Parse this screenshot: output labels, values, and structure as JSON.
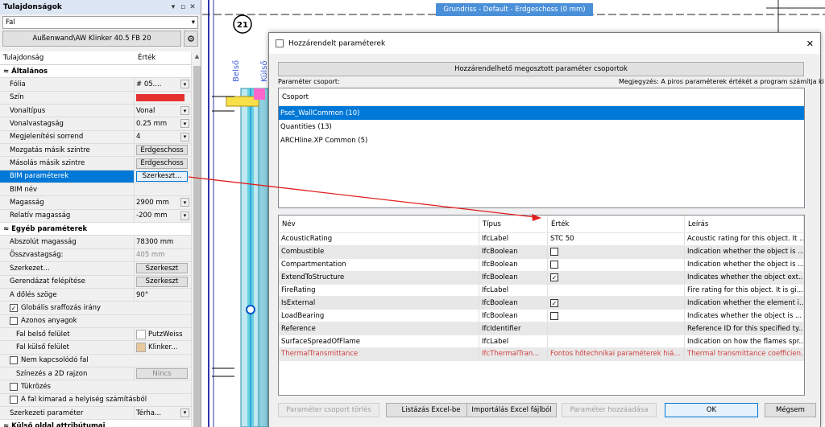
{
  "left_panel": {
    "title": "Tulajdonságok",
    "combo_value": "Fal",
    "type_button": "Außenwand\\AW Klinker 40.5 FB 20",
    "col_property": "Tulajdonság",
    "col_value": "Érték",
    "rows": [
      {
        "kind": "sec",
        "label": "Általános"
      },
      {
        "label": "Fólia",
        "value": "# 05....",
        "dd": true
      },
      {
        "label": "Szín",
        "swatch": "#e53030"
      },
      {
        "label": "Vonaltípus",
        "value": "Vonal",
        "dd": true
      },
      {
        "label": "Vonalvastagság",
        "value": "0.25 mm",
        "dd": true
      },
      {
        "label": "Megjelenítési sorrend",
        "value": "4",
        "dd": true
      },
      {
        "label": "Mozgatás másik szintre",
        "button": "Erdgeschoss"
      },
      {
        "label": "Másolás másik szintre",
        "button": "Erdgeschoss"
      },
      {
        "label": "BIM paraméterek",
        "button": "Szerkeszt...",
        "selected": true
      },
      {
        "label": "BIM név"
      },
      {
        "label": "Magasság",
        "value": "2900 mm",
        "dd": true
      },
      {
        "label": "Relatív magasság",
        "value": "-200 mm",
        "dd": true
      },
      {
        "kind": "sec",
        "label": "Egyéb paraméterek"
      },
      {
        "label": "Abszolút magasság",
        "value": "78300 mm"
      },
      {
        "label": "Összvastagság:",
        "value": "405 mm",
        "muted": true
      },
      {
        "label": "Szerkezet...",
        "button": "Szerkeszt"
      },
      {
        "label": "Gerendázat felépítése",
        "button": "Szerkeszt"
      },
      {
        "label": "A dőlés szöge",
        "value": "90°"
      },
      {
        "label": "Globális sraffozás irány",
        "check": true,
        "checked": true,
        "full": true
      },
      {
        "label": "Azonos anyagok",
        "check": true,
        "checked": false,
        "full": true
      },
      {
        "label": "Fal belső felület",
        "value": "PutzWeiss",
        "swatch": "#ffffff",
        "indent": true
      },
      {
        "label": "Fal külső felület",
        "value": "Klinker...",
        "swatch": "#e8c89a",
        "indent": true
      },
      {
        "label": "Nem kapcsolódó fal",
        "check": true,
        "checked": false,
        "full": true
      },
      {
        "label": "Színezés a 2D rajzon",
        "button": "Nincs",
        "indent": true,
        "muted": true
      },
      {
        "label": "Tükrözés",
        "check": true,
        "checked": false,
        "full": true
      },
      {
        "label": "A fal kimarad a helyiség számításból",
        "check": true,
        "checked": false,
        "full": true
      },
      {
        "label": "Szerkezeti paraméter",
        "value": "Térha...",
        "dd": true
      },
      {
        "kind": "sec",
        "label": "Külső oldal attribútumai"
      }
    ]
  },
  "cad": {
    "view_title": "Grundriss - Default - Erdgeschoss (0 mm)",
    "marker": "21",
    "label_belso": "Belső",
    "label_kulso": "Külső"
  },
  "dialog": {
    "title": "Hozzárendelt paraméterek",
    "group_button": "Hozzárendelhető megosztott paraméter csoportok",
    "group_label": "Paraméter csoport:",
    "note": "Megjegyzés: A piros paraméterek értékét a program számítja ki!",
    "group_header": "Csoport",
    "groups": [
      "Pset_WallCommon (10)",
      "Quantities (13)",
      "ARCHline.XP Common (5)"
    ],
    "param_headers": [
      "Név",
      "Típus",
      "Érték",
      "Leírás"
    ],
    "params": [
      {
        "name": "AcousticRating",
        "type": "IfcLabel",
        "value": "STC 50",
        "desc": "Acoustic rating for this object. It ..."
      },
      {
        "name": "Combustible",
        "type": "IfcBoolean",
        "check": false,
        "desc": "Indication whether the object is ..."
      },
      {
        "name": "Compartmentation",
        "type": "IfcBoolean",
        "check": false,
        "desc": "Indication whether the object is ..."
      },
      {
        "name": "ExtendToStructure",
        "type": "IfcBoolean",
        "check": true,
        "desc": "Indicates whether the object ext..."
      },
      {
        "name": "FireRating",
        "type": "IfcLabel",
        "value": "",
        "desc": "Fire rating for this object. It is gi..."
      },
      {
        "name": "IsExternal",
        "type": "IfcBoolean",
        "check": true,
        "desc": "Indication whether the element i..."
      },
      {
        "name": "LoadBearing",
        "type": "IfcBoolean",
        "check": false,
        "desc": "Indicates whether the object is ..."
      },
      {
        "name": "Reference",
        "type": "IfcIdentifier",
        "value": "",
        "desc": "Reference ID for this specified ty..."
      },
      {
        "name": "SurfaceSpreadOfFlame",
        "type": "IfcLabel",
        "value": "",
        "desc": "Indication on how the flames spr..."
      },
      {
        "name": "ThermalTransmittance",
        "type": "IfcThermalTran...",
        "value": "Fontos hőtechnikai paraméterek hiá...",
        "desc": "Thermal transmittance coefficien...",
        "red": true
      }
    ],
    "buttons": [
      "Paraméter csoport törlés",
      "Listázás Excel-be",
      "Importálás Excel fájlból",
      "Paraméter hozzáadása",
      "OK",
      "Mégsem"
    ]
  },
  "colors": {
    "accent": "#0078d7",
    "arrow": "#e02020",
    "title_blue": "#4a90d9"
  }
}
